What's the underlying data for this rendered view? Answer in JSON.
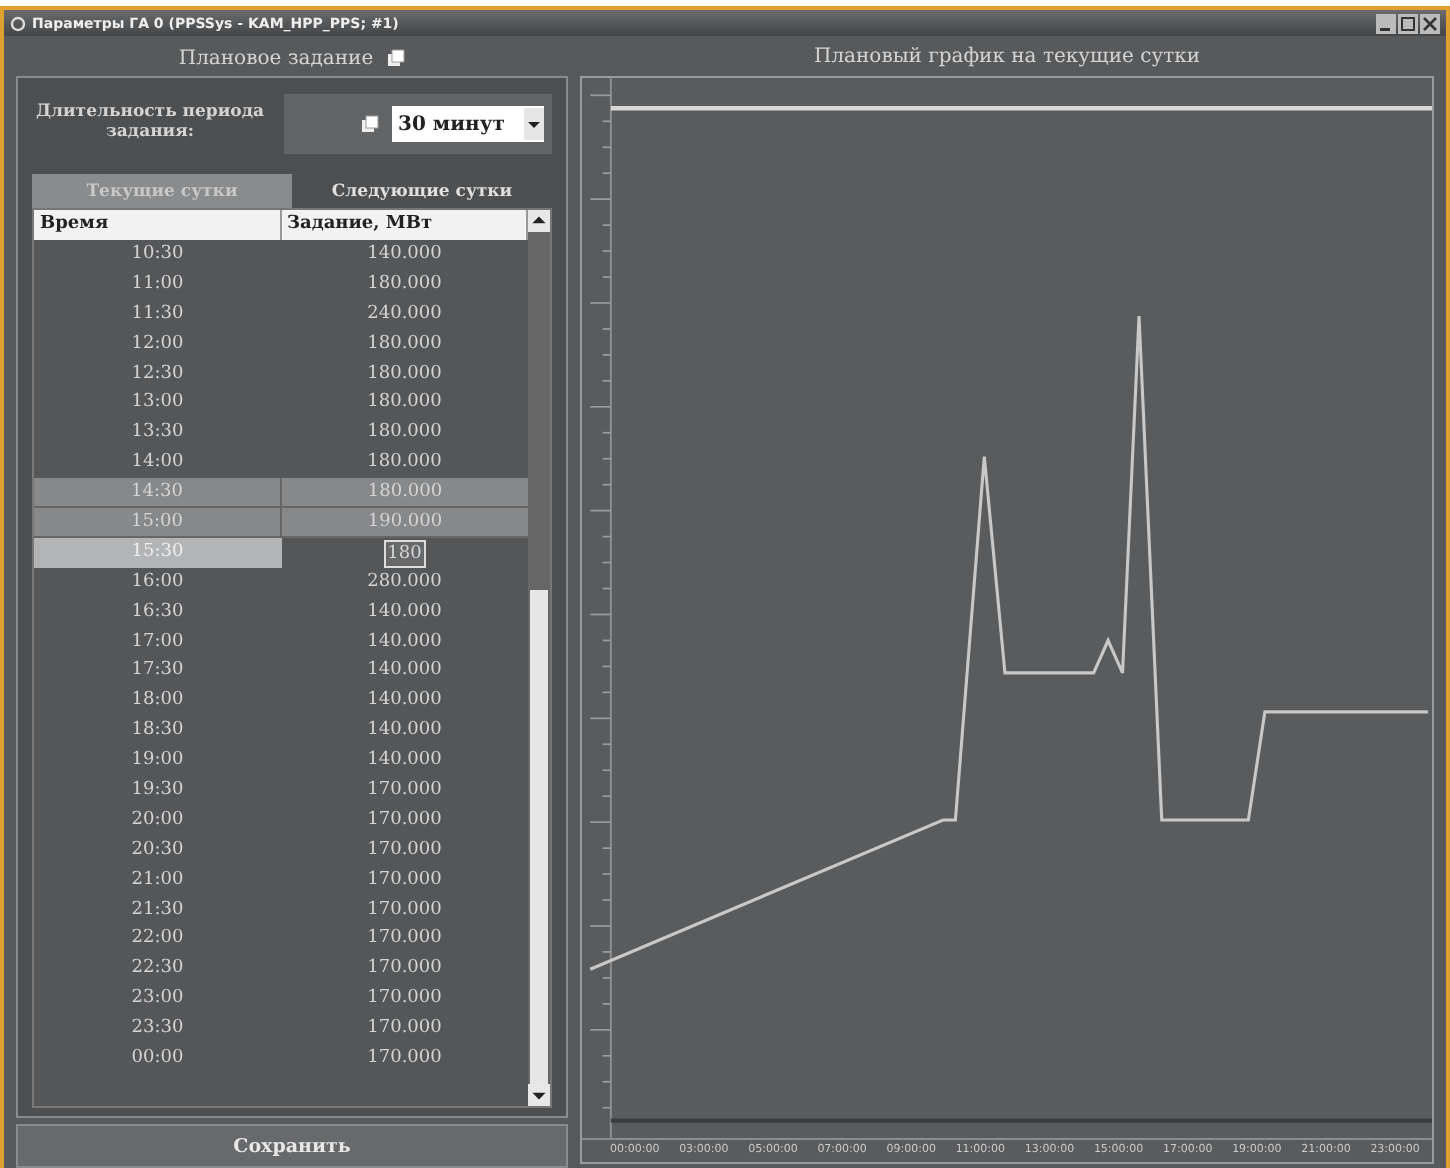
{
  "window": {
    "title": "Параметры ГА 0 (PPSSys - KAM_HPP_PPS; #1)"
  },
  "left_panel": {
    "title": "Плановое задание",
    "duration_label": "Длительность периода задания:",
    "duration_value": "30 минут",
    "tabs": [
      {
        "label": "Текущие сутки",
        "selected": true
      },
      {
        "label": "Следующие сутки",
        "selected": false
      }
    ],
    "table": {
      "columns": [
        "Время",
        "Задание, МВт"
      ],
      "rows": [
        {
          "time": "10:30",
          "value": "140.000",
          "selected": false,
          "editing": false
        },
        {
          "time": "11:00",
          "value": "180.000",
          "selected": false,
          "editing": false
        },
        {
          "time": "11:30",
          "value": "240.000",
          "selected": false,
          "editing": false
        },
        {
          "time": "12:00",
          "value": "180.000",
          "selected": false,
          "editing": false
        },
        {
          "time": "12:30",
          "value": "180.000",
          "selected": false,
          "editing": false
        },
        {
          "time": "13:00",
          "value": "180.000",
          "selected": false,
          "editing": false
        },
        {
          "time": "13:30",
          "value": "180.000",
          "selected": false,
          "editing": false
        },
        {
          "time": "14:00",
          "value": "180.000",
          "selected": false,
          "editing": false
        },
        {
          "time": "14:30",
          "value": "180.000",
          "selected": true,
          "editing": false
        },
        {
          "time": "15:00",
          "value": "190.000",
          "selected": true,
          "editing": false
        },
        {
          "time": "15:30",
          "value": "180",
          "selected": false,
          "editing": true
        },
        {
          "time": "16:00",
          "value": "280.000",
          "selected": false,
          "editing": false
        },
        {
          "time": "16:30",
          "value": "140.000",
          "selected": false,
          "editing": false
        },
        {
          "time": "17:00",
          "value": "140.000",
          "selected": false,
          "editing": false
        },
        {
          "time": "17:30",
          "value": "140.000",
          "selected": false,
          "editing": false
        },
        {
          "time": "18:00",
          "value": "140.000",
          "selected": false,
          "editing": false
        },
        {
          "time": "18:30",
          "value": "140.000",
          "selected": false,
          "editing": false
        },
        {
          "time": "19:00",
          "value": "140.000",
          "selected": false,
          "editing": false
        },
        {
          "time": "19:30",
          "value": "170.000",
          "selected": false,
          "editing": false
        },
        {
          "time": "20:00",
          "value": "170.000",
          "selected": false,
          "editing": false
        },
        {
          "time": "20:30",
          "value": "170.000",
          "selected": false,
          "editing": false
        },
        {
          "time": "21:00",
          "value": "170.000",
          "selected": false,
          "editing": false
        },
        {
          "time": "21:30",
          "value": "170.000",
          "selected": false,
          "editing": false
        },
        {
          "time": "22:00",
          "value": "170.000",
          "selected": false,
          "editing": false
        },
        {
          "time": "22:30",
          "value": "170.000",
          "selected": false,
          "editing": false
        },
        {
          "time": "23:00",
          "value": "170.000",
          "selected": false,
          "editing": false
        },
        {
          "time": "23:30",
          "value": "170.000",
          "selected": false,
          "editing": false
        },
        {
          "time": "00:00",
          "value": "170.000",
          "selected": false,
          "editing": false
        }
      ]
    },
    "save_button": "Сохранить"
  },
  "right_panel": {
    "title": "Плановый график на текущие сутки",
    "x_tick_labels": [
      "00:00:00",
      "03:00:00",
      "05:00:00",
      "07:00:00",
      "09:00:00",
      "11:00:00",
      "13:00:00",
      "15:00:00",
      "17:00:00",
      "19:00:00",
      "21:00:00",
      "23:00:00"
    ]
  }
}
